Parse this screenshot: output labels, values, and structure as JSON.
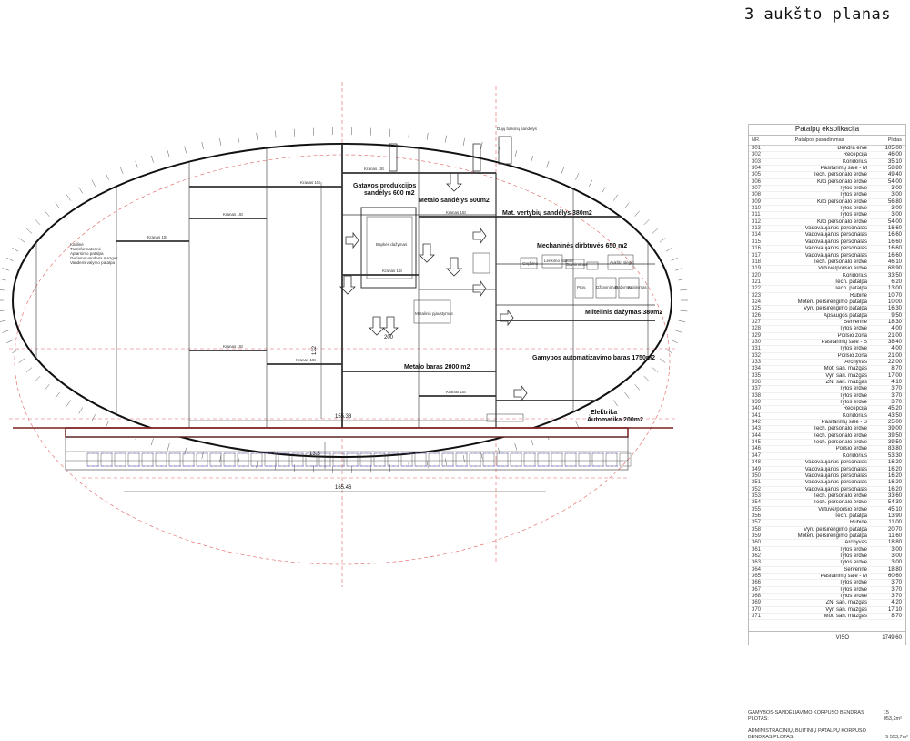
{
  "title": "3 aukšto planas",
  "plan": {
    "areas": {
      "gatavos": [
        "Gatavos produkcijos",
        "sandėlys 600 m2"
      ],
      "metalo_600": "Metalo sandėlys 600m2",
      "mat_vertybiu": "Mat. vertybių sandėlys 380m2",
      "mechanines": "Mechaninės dirbtuvės 650 m2",
      "miltelinis": "Miltelinis dažymas 380m2",
      "gamybos_autom": "Gamybos automatizavimo baras 1750m2",
      "metalo_2000": "Metalo baras 2000 m2",
      "elektrika": [
        "Elektrika",
        "Automatika 200m2"
      ],
      "dazymas": "Bapkės dažymas",
      "kranas": "Kranas 15t"
    },
    "left_notes": [
      "Katilinė",
      "Transformatorinė",
      "Aptarnimo patalpa",
      "Geriamo vandens mazgas",
      "Vandens valymo patalpa"
    ],
    "dimensions": {
      "d1": "155.38",
      "d2": "165.46",
      "d3": "13.5",
      "d4": "132",
      "d5": "200"
    },
    "small_labels": [
      "Prov.",
      "Džiovinimas",
      "Dažymas",
      "Kaitinimas",
      "Gręžimo",
      "Lenkimo staklės",
      "Suvirinimas",
      "Aukšto slėgio",
      "Dujų balionų sandėlys",
      "Metalinis pjaustymas"
    ]
  },
  "legend": {
    "title": "Patalpų eksplikacija",
    "col_nr": "NR.",
    "col_name": "Patalpos pavadinimas",
    "col_area": "Plotas",
    "rows": [
      [
        "301",
        "Bendra erve",
        "105,00"
      ],
      [
        "302",
        "Recepcija",
        "46,00"
      ],
      [
        "303",
        "Koridorius",
        "35,10"
      ],
      [
        "304",
        "Pasitarimų salė - M",
        "58,80"
      ],
      [
        "305",
        "Tech. personalo erdvė",
        "49,40"
      ],
      [
        "306",
        "Kito personalo erdvė",
        "54,00"
      ],
      [
        "307",
        "Tylos erdvė",
        "3,00"
      ],
      [
        "308",
        "Tylos erdvė",
        "3,00"
      ],
      [
        "309",
        "Kito personalo erdvė",
        "56,80"
      ],
      [
        "310",
        "Tylos erdvė",
        "3,00"
      ],
      [
        "311",
        "Tylos erdvė",
        "3,00"
      ],
      [
        "312",
        "Kito personalo erdvė",
        "54,00"
      ],
      [
        "313",
        "Vadovaujantis personalas",
        "16,60"
      ],
      [
        "314",
        "Vadovaujantis personalas",
        "16,60"
      ],
      [
        "315",
        "Vadovaujantis personalas",
        "16,60"
      ],
      [
        "316",
        "Vadovaujantis personalas",
        "16,60"
      ],
      [
        "317",
        "Vadovaujantis personalas",
        "16,60"
      ],
      [
        "318",
        "Tech. personalo erdvė",
        "46,10"
      ],
      [
        "319",
        "Virtuvė/poilsio erdvė",
        "68,90"
      ],
      [
        "320",
        "Koridorius",
        "33,50"
      ],
      [
        "321",
        "Tech. patalpa",
        "6,20"
      ],
      [
        "322",
        "Tech. patalpa",
        "13,00"
      ],
      [
        "323",
        "Rūbinė",
        "10,70"
      ],
      [
        "324",
        "Moterų persirengimo patalpa",
        "10,00"
      ],
      [
        "325",
        "Vyrų persirengimo patalpa",
        "16,30"
      ],
      [
        "326",
        "Apsaugos patalpa",
        "9,50"
      ],
      [
        "327",
        "Serverinė",
        "18,30"
      ],
      [
        "328",
        "Tylos erdvė",
        "4,00"
      ],
      [
        "329",
        "Poilsio zona",
        "21,00"
      ],
      [
        "330",
        "Pasitarimų salė - S",
        "38,40"
      ],
      [
        "331",
        "Tylos erdvė",
        "4,00"
      ],
      [
        "332",
        "Poilsio zona",
        "21,00"
      ],
      [
        "333",
        "Archyvas",
        "22,00"
      ],
      [
        "334",
        "Mot. san. mazgas",
        "8,70"
      ],
      [
        "335",
        "Vyr. san. mazgas",
        "17,00"
      ],
      [
        "336",
        "ŽN. san. mazgas",
        "4,10"
      ],
      [
        "337",
        "Tylos erdvė",
        "3,70"
      ],
      [
        "338",
        "Tylos erdvė",
        "3,70"
      ],
      [
        "339",
        "Tylos erdvė",
        "3,70"
      ],
      [
        "340",
        "Recepcija",
        "45,20"
      ],
      [
        "341",
        "Koridorius",
        "43,50"
      ],
      [
        "342",
        "Pasitarimų salė - S",
        "25,00"
      ],
      [
        "343",
        "Tech. personalo erdvė",
        "39,00"
      ],
      [
        "344",
        "Tech. personalo erdvė",
        "39,50"
      ],
      [
        "345",
        "Tech. personalo erdvė",
        "39,50"
      ],
      [
        "346",
        "Poilsio erdvė",
        "83,80"
      ],
      [
        "347",
        "Koridorius",
        "53,30"
      ],
      [
        "348",
        "Vadovaujantis personalas",
        "16,20"
      ],
      [
        "349",
        "Vadovaujantis personalas",
        "16,20"
      ],
      [
        "350",
        "Vadovaujantis personalas",
        "16,20"
      ],
      [
        "351",
        "Vadovaujantis personalas",
        "16,20"
      ],
      [
        "352",
        "Vadovaujantis personalas",
        "16,20"
      ],
      [
        "353",
        "Tech. personalo erdvė",
        "33,60"
      ],
      [
        "354",
        "Tech. personalo erdvė",
        "54,30"
      ],
      [
        "355",
        "Virtuvė/poilsio erdvė",
        "45,10"
      ],
      [
        "356",
        "Tech. patalpa",
        "13,90"
      ],
      [
        "357",
        "Rūbinė",
        "11,00"
      ],
      [
        "358",
        "Vyrų persirengimo patalpa",
        "20,70"
      ],
      [
        "359",
        "Moterų persirengimo patalpa",
        "11,60"
      ],
      [
        "360",
        "Archyvas",
        "18,80"
      ],
      [
        "361",
        "Tylos erdvė",
        "3,00"
      ],
      [
        "362",
        "Tylos erdvė",
        "3,00"
      ],
      [
        "363",
        "Tylos erdvė",
        "3,00"
      ],
      [
        "364",
        "Serverinė",
        "18,80"
      ],
      [
        "365",
        "Pasitarimų salė - M",
        "60,60"
      ],
      [
        "366",
        "Tylos erdvė",
        "3,70"
      ],
      [
        "367",
        "Tylos erdvė",
        "3,70"
      ],
      [
        "368",
        "Tylos erdvė",
        "3,70"
      ],
      [
        "369",
        "ŽN. san. mazgas",
        "4,20"
      ],
      [
        "370",
        "Vyr. san. mazgas",
        "17,10"
      ],
      [
        "371",
        "Mot. san. mazgas",
        "8,70"
      ]
    ],
    "viso_label": "VISO",
    "viso_value": "1749,60"
  },
  "totals": {
    "line1_label": "GAMYBOS-SANDĖLIAVIMO KORPUSO BENDRAS PLOTAS:",
    "line1_value": "15 053,2m²",
    "line2_label": "ADMINISTRACINIŲ, BUITINIŲ PATALPŲ KORPUSO",
    "line3_label": "BENDRAS PLOTAS:",
    "line3_value": "5 553,7m²"
  }
}
